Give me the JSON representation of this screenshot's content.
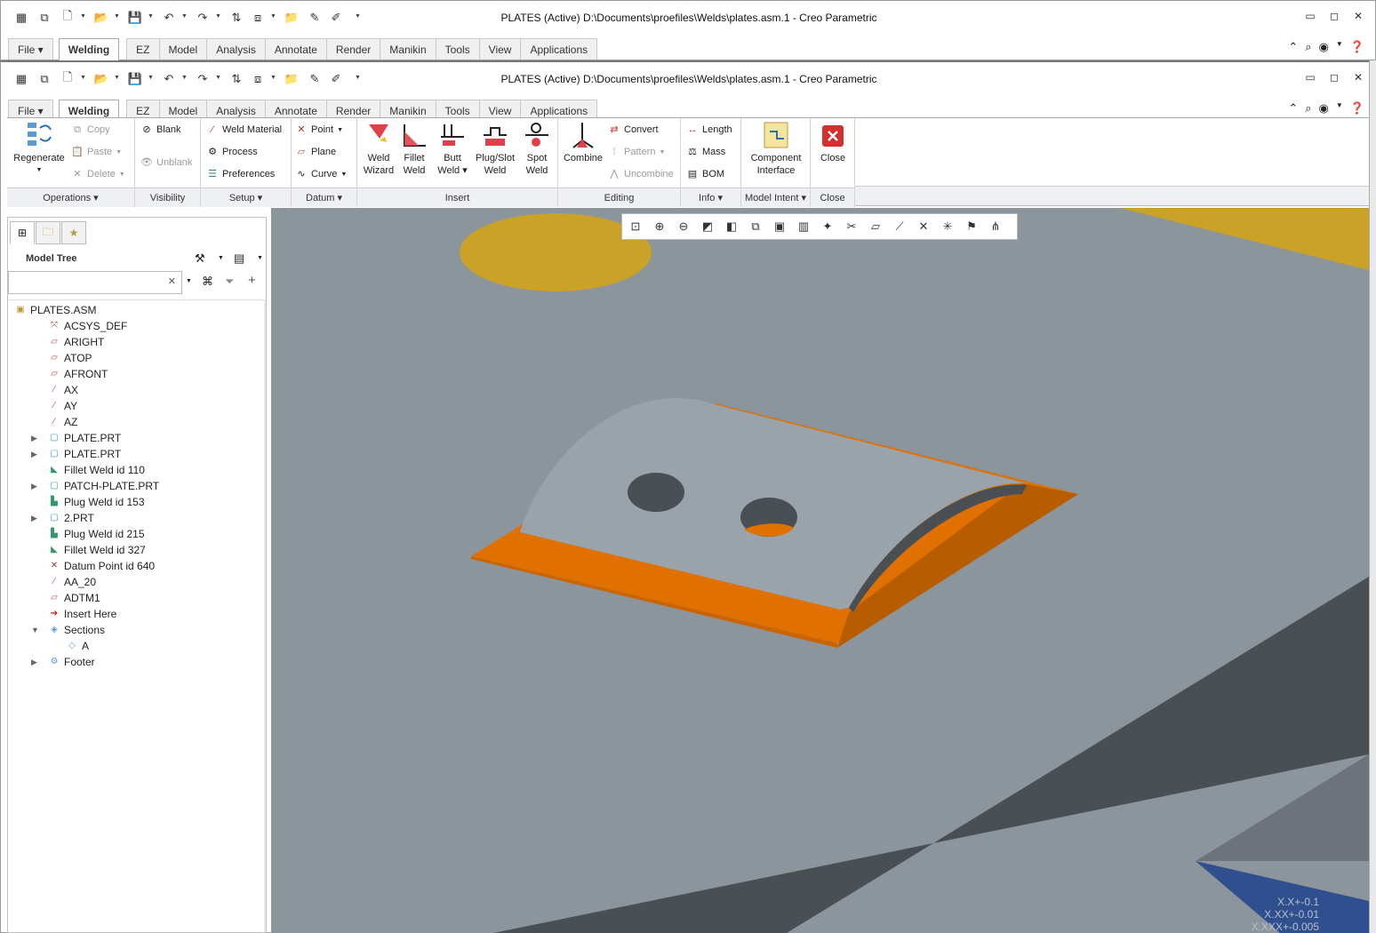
{
  "window": {
    "title": "PLATES (Active) D:\\Documents\\proefiles\\Welds\\plates.asm.1 - Creo Parametric"
  },
  "tabs": [
    "File",
    "Welding",
    "EZ",
    "Model",
    "Analysis",
    "Annotate",
    "Render",
    "Manikin",
    "Tools",
    "View",
    "Applications"
  ],
  "ribbon": {
    "operations": {
      "regenerate": "Regenerate",
      "copy": "Copy",
      "paste": "Paste",
      "delete": "Delete",
      "label": "Operations"
    },
    "visibility": {
      "blank": "Blank",
      "unblank": "Unblank",
      "label": "Visibility"
    },
    "setup": {
      "weld_material": "Weld Material",
      "process": "Process",
      "preferences": "Preferences",
      "label": "Setup"
    },
    "datum": {
      "point": "Point",
      "plane": "Plane",
      "curve": "Curve",
      "label": "Datum"
    },
    "insert": {
      "weld_wizard_1": "Weld",
      "weld_wizard_2": "Wizard",
      "fillet_1": "Fillet",
      "fillet_2": "Weld",
      "butt_1": "Butt",
      "butt_2": "Weld",
      "plug_1": "Plug/Slot",
      "plug_2": "Weld",
      "spot_1": "Spot",
      "spot_2": "Weld",
      "label": "Insert"
    },
    "editing": {
      "combine": "Combine",
      "convert": "Convert",
      "pattern": "Pattern",
      "uncombine": "Uncombine",
      "label": "Editing"
    },
    "info": {
      "length": "Length",
      "mass": "Mass",
      "bom": "BOM",
      "label": "Info"
    },
    "model_intent": {
      "component_1": "Component",
      "component_2": "Interface",
      "label": "Model Intent"
    },
    "close": {
      "close": "Close",
      "label": "Close"
    }
  },
  "panel": {
    "header": "Model Tree",
    "search_value": "",
    "tree": [
      {
        "label": "PLATES.ASM",
        "icon": "assembly-icon",
        "level": 0
      },
      {
        "label": "ACSYS_DEF",
        "icon": "csys-icon",
        "level": 1
      },
      {
        "label": "ARIGHT",
        "icon": "datum-plane-icon",
        "level": 1
      },
      {
        "label": "ATOP",
        "icon": "datum-plane-icon",
        "level": 1
      },
      {
        "label": "AFRONT",
        "icon": "datum-plane-icon",
        "level": 1
      },
      {
        "label": "AX",
        "icon": "datum-axis-icon",
        "level": 1
      },
      {
        "label": "AY",
        "icon": "datum-axis-icon",
        "level": 1
      },
      {
        "label": "AZ",
        "icon": "datum-axis-icon",
        "level": 1
      },
      {
        "label": "PLATE.PRT",
        "icon": "part-icon",
        "level": 1,
        "expand": true
      },
      {
        "label": "PLATE.PRT",
        "icon": "part-icon",
        "level": 1,
        "expand": true
      },
      {
        "label": "Fillet Weld id 110",
        "icon": "fillet-weld-icon",
        "level": 1
      },
      {
        "label": "PATCH-PLATE.PRT",
        "icon": "part-icon",
        "level": 1,
        "expand": true
      },
      {
        "label": "Plug Weld id 153",
        "icon": "plug-weld-icon",
        "level": 1
      },
      {
        "label": "2.PRT",
        "icon": "part-icon",
        "level": 1,
        "expand": true
      },
      {
        "label": "Plug Weld id 215",
        "icon": "plug-weld-icon",
        "level": 1
      },
      {
        "label": "Fillet Weld id 327",
        "icon": "fillet-weld-icon",
        "level": 1
      },
      {
        "label": "Datum Point id 640",
        "icon": "datum-point-icon",
        "level": 1
      },
      {
        "label": "AA_20",
        "icon": "datum-axis-icon",
        "level": 1
      },
      {
        "label": "ADTM1",
        "icon": "datum-plane-icon",
        "level": 1
      },
      {
        "label": "Insert Here",
        "icon": "insert-arrow-icon",
        "level": 1
      },
      {
        "label": "Sections",
        "icon": "sections-icon",
        "level": 1,
        "expand": true,
        "open": true
      },
      {
        "label": "A",
        "icon": "section-icon",
        "level": 2
      },
      {
        "label": "Footer",
        "icon": "footer-icon",
        "level": 1,
        "expand": true
      }
    ]
  },
  "viewport": {
    "tolerance": [
      "X.X+-0.1",
      "X.XX+-0.01",
      "X.XXX+-0.005"
    ],
    "colors": {
      "background": "#8c949c",
      "weld": "#e07000",
      "plate": "#9aa2aa",
      "gold": "#c9a227",
      "dark": "#4a4f54",
      "blue": "#2f4f8f"
    }
  }
}
